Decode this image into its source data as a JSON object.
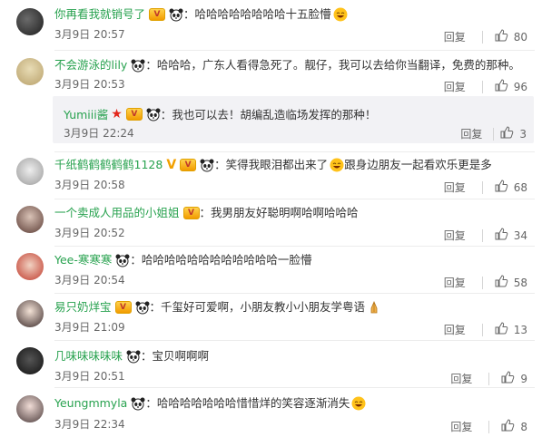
{
  "comments": [
    {
      "name": "你再看我就销号了",
      "colon": "：",
      "text": "哈哈哈哈哈哈哈哈十五脸懵",
      "date": "3月9日 20:57",
      "reply": "回复",
      "likes": "80",
      "badges": [
        "vip",
        "panda"
      ],
      "emoji": "laugh"
    },
    {
      "name": "不会游泳的lily",
      "colon": "：",
      "text": "哈哈哈，广东人看得急死了。靓仔，我可以去给你当翻译，免费的那种。",
      "date": "3月9日 20:53",
      "reply": "回复",
      "likes": "96",
      "badges": [
        "panda"
      ]
    },
    {
      "name": "千纸鹤鹤鹤鹤鹤1128",
      "colon": "：",
      "text": "笑得我眼泪都出来了",
      "text2": "跟身边朋友一起看欢乐更是多",
      "date": "3月9日 20:58",
      "reply": "回复",
      "likes": "68",
      "badges": [
        "v",
        "vip",
        "panda"
      ],
      "emoji": "laugh"
    },
    {
      "name": "一个卖成人用品的小姐姐",
      "colon": "：",
      "text": "我男朋友好聪明啊哈啊哈哈哈",
      "date": "3月9日 20:52",
      "reply": "回复",
      "likes": "34",
      "badges": [
        "vip"
      ]
    },
    {
      "name": "Yee-寒寒寒",
      "colon": "：",
      "text": "哈哈哈哈哈哈哈哈哈哈哈哈一脸懵",
      "date": "3月9日 20:54",
      "reply": "回复",
      "likes": "58",
      "badges": [
        "panda"
      ]
    },
    {
      "name": "易只奶烊宝",
      "colon": "：",
      "text": "千玺好可爱啊，小朋友教小小朋友学粤语",
      "date": "3月9日 21:09",
      "reply": "回复",
      "likes": "13",
      "badges": [
        "vip",
        "panda"
      ],
      "emoji": "pray"
    },
    {
      "name": "几味味味味味",
      "colon": "：",
      "text": "宝贝啊啊啊",
      "date": "3月9日 20:51",
      "reply": "回复",
      "likes": "9",
      "badges": [
        "panda"
      ]
    },
    {
      "name": "Yeungmmyla",
      "colon": "：",
      "text": "哈哈哈哈哈哈哈惜惜烊的笑容逐渐消失",
      "date": "3月9日 22:34",
      "reply": "回复",
      "likes": "8",
      "badges": [
        "panda"
      ],
      "emoji": "laugh"
    }
  ],
  "subreply": {
    "name": "Yumiii酱",
    "colon": "：",
    "text": "我也可以去！胡编乱造临场发挥的那种！",
    "date": "3月9日 22:24",
    "reply": "回复",
    "likes": "3"
  },
  "colors": {
    "username": "#28a24f",
    "text": "#333333",
    "meta": "#666666",
    "subbox": "#f2f2f5"
  }
}
